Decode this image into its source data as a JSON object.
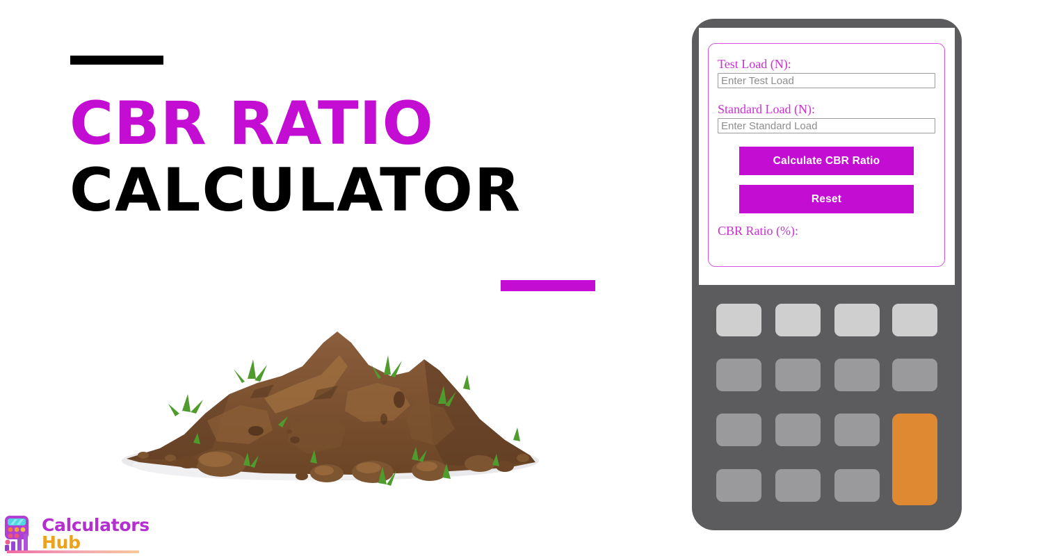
{
  "hero": {
    "title_line_1": "CBR RATIO",
    "title_line_2": "CALCULATOR",
    "accent_color_magenta": "#c40dd2",
    "accent_color_black": "#000000",
    "illustration": "soil-dirt-pile-with-grass"
  },
  "logo": {
    "word_1": "Calculators",
    "word_2": "Hub",
    "word_1_color": "#b42fd0",
    "word_2_color": "#eda21e",
    "mark": "calculator-bar-chart-icon"
  },
  "calculator": {
    "frame_color": "#5c5c5e",
    "screen_background": "#ffffff",
    "form_border_color": "#d753e3",
    "form": {
      "fields": [
        {
          "label": "Test Load (N):",
          "placeholder": "Enter Test Load",
          "value": ""
        },
        {
          "label": "Standard Load (N):",
          "placeholder": "Enter Standard Load",
          "value": ""
        }
      ],
      "buttons": [
        {
          "label": "Calculate CBR Ratio",
          "color": "#c40dd2"
        },
        {
          "label": "Reset",
          "color": "#c40dd2"
        }
      ],
      "result": {
        "label": "CBR Ratio (%):",
        "value": ""
      }
    },
    "keypad": {
      "rows": 4,
      "columns": 4,
      "top_row_color": "#cfcfcf",
      "key_color": "#9a9a9c",
      "accent_key_color": "#df8a33",
      "keys": [
        {
          "type": "light",
          "label": ""
        },
        {
          "type": "light",
          "label": ""
        },
        {
          "type": "light",
          "label": ""
        },
        {
          "type": "light",
          "label": ""
        },
        {
          "type": "grey",
          "label": ""
        },
        {
          "type": "grey",
          "label": ""
        },
        {
          "type": "grey",
          "label": ""
        },
        {
          "type": "grey",
          "label": ""
        },
        {
          "type": "grey",
          "label": ""
        },
        {
          "type": "grey",
          "label": ""
        },
        {
          "type": "grey",
          "label": ""
        },
        {
          "type": "grey",
          "label": ""
        },
        {
          "type": "grey",
          "label": ""
        },
        {
          "type": "grey",
          "label": ""
        },
        {
          "type": "orange",
          "label": ""
        }
      ]
    }
  }
}
